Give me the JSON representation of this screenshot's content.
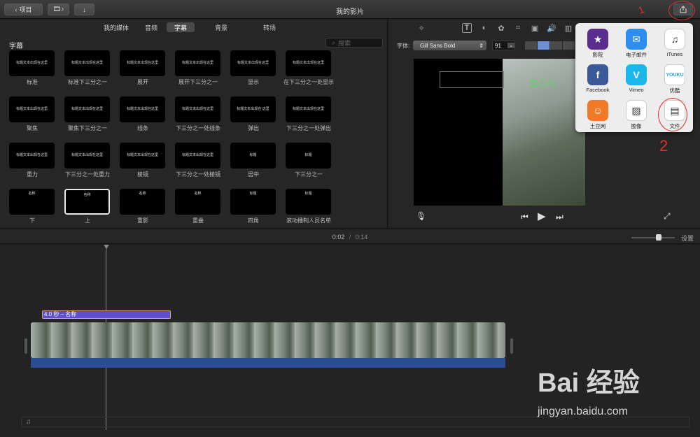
{
  "toolbar": {
    "back_label": "项目",
    "title": "我的影片"
  },
  "browser": {
    "tabs": [
      "我的媒体",
      "音频",
      "字幕",
      "背景",
      "转场"
    ],
    "selected_tab": "字幕",
    "section_title": "字幕",
    "search_placeholder": "搜索",
    "titles": [
      {
        "label": "标准",
        "text": "标题文本出现在这里"
      },
      {
        "label": "标准下三分之一",
        "text": "标题文本出现在这里"
      },
      {
        "label": "展开",
        "text": "标题文本出现在这里"
      },
      {
        "label": "展开下三分之一",
        "text": "标题文本出现在这里"
      },
      {
        "label": "显示",
        "text": "标题文本出现在这里"
      },
      {
        "label": "在下三分之一处显示",
        "text": "标题文本出现在这里"
      },
      {
        "label": "聚焦",
        "text": "标题文本出现在这里"
      },
      {
        "label": "聚焦下三分之一",
        "text": "标题文本出现在这里"
      },
      {
        "label": "线条",
        "text": "标题文本出现在这里"
      },
      {
        "label": "下三分之一处线条",
        "text": "标题文本出现在这里"
      },
      {
        "label": "弹出",
        "text": "标题文本出现在 这里"
      },
      {
        "label": "下三分之一处弹出",
        "text": "标题文本出现在这里"
      },
      {
        "label": "重力",
        "text": "标题文本出现在这里"
      },
      {
        "label": "下三分之一处重力",
        "text": "标题文本出现在这里"
      },
      {
        "label": "棱镜",
        "text": "标题文本出现在这里"
      },
      {
        "label": "下三分之一处棱镜",
        "text": "标题文本出现在这里"
      },
      {
        "label": "居中",
        "text": "标题"
      },
      {
        "label": "下三分之一",
        "text": "标题"
      },
      {
        "label": "下",
        "text": "名称"
      },
      {
        "label": "上",
        "text": "名称"
      },
      {
        "label": "重影",
        "text": "名称"
      },
      {
        "label": "重叠",
        "text": "名称"
      },
      {
        "label": "四角",
        "text": "标题"
      },
      {
        "label": "滚动播制人员名单",
        "text": "标题"
      }
    ]
  },
  "viewer": {
    "font_label": "字体:",
    "font_value": "Gill Sans Bold",
    "size_value": "91",
    "overlay_text": "此心心"
  },
  "share": {
    "items": [
      {
        "label": "影院",
        "icon": "theater-icon",
        "color": "#5b2d8e",
        "glyph": "★"
      },
      {
        "label": "电子邮件",
        "icon": "mail-icon",
        "color": "#2d8ef0",
        "glyph": "✉"
      },
      {
        "label": "iTunes",
        "icon": "itunes-icon",
        "color": "#ffffff",
        "glyph": "♫"
      },
      {
        "label": "Facebook",
        "icon": "facebook-icon",
        "color": "#3b5998",
        "glyph": "f"
      },
      {
        "label": "Vimeo",
        "icon": "vimeo-icon",
        "color": "#1ab7ea",
        "glyph": "V"
      },
      {
        "label": "优酷",
        "icon": "youku-icon",
        "color": "#ffffff",
        "glyph": "YOUKU"
      },
      {
        "label": "土豆网",
        "icon": "tudou-icon",
        "color": "#f07a28",
        "glyph": "☺"
      },
      {
        "label": "图像",
        "icon": "image-icon",
        "color": "#ffffff",
        "glyph": "▨"
      },
      {
        "label": "文件",
        "icon": "film-file-icon",
        "color": "#ffffff",
        "glyph": "▤"
      }
    ]
  },
  "timeline": {
    "current_time": "0:02",
    "separator": "/",
    "total_time": "0:14",
    "settings_label": "设置",
    "title_clip_label": "4.0 秒 – 名称"
  },
  "watermark": {
    "brand": "Bai 经验",
    "url": "jingyan.baidu.com"
  },
  "annotations": {
    "mark1": "1",
    "mark2": "2"
  }
}
